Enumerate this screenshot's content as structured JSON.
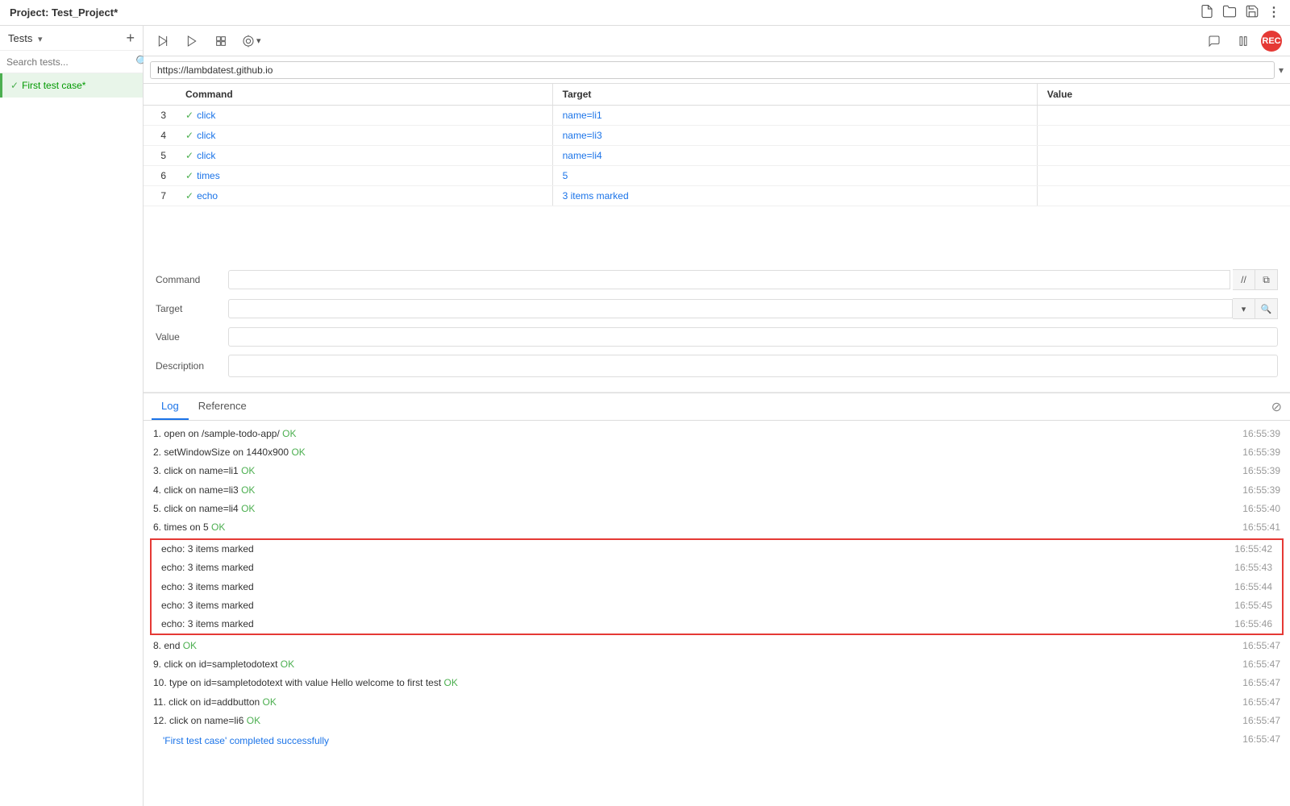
{
  "topbar": {
    "title": "Project: ",
    "project_name": "Test_Project*"
  },
  "left_panel": {
    "tests_label": "Tests",
    "dropdown_arrow": "▾",
    "add_btn": "+",
    "search_placeholder": "Search tests...",
    "test_item": "First test case*"
  },
  "toolbar": {
    "url": "https://lambdatest.github.io"
  },
  "table": {
    "columns": [
      "Command",
      "Target",
      "Value"
    ],
    "rows": [
      {
        "num": "3",
        "command": "click",
        "target": "name=li1",
        "value": ""
      },
      {
        "num": "4",
        "command": "click",
        "target": "name=li3",
        "value": ""
      },
      {
        "num": "5",
        "command": "click",
        "target": "name=li4",
        "value": ""
      },
      {
        "num": "6",
        "command": "times",
        "target": "5",
        "value": ""
      },
      {
        "num": "7",
        "command": "echo",
        "target": "3 items marked",
        "value": ""
      }
    ]
  },
  "cmd_edit": {
    "command_label": "Command",
    "target_label": "Target",
    "value_label": "Value",
    "description_label": "Description"
  },
  "log": {
    "tab_log": "Log",
    "tab_reference": "Reference",
    "entries": [
      {
        "text": "1.  open on /sample-todo-app/",
        "ok": "OK",
        "time": "16:55:39"
      },
      {
        "text": "2.  setWindowSize on 1440x900",
        "ok": "OK",
        "time": "16:55:39"
      },
      {
        "text": "3.  click on name=li1",
        "ok": "OK",
        "time": "16:55:39"
      },
      {
        "text": "4.  click on name=li3",
        "ok": "OK",
        "time": "16:55:39"
      },
      {
        "text": "5.  click on name=li4",
        "ok": "OK",
        "time": "16:55:40"
      },
      {
        "text": "6.  times on 5",
        "ok": "OK",
        "time": "16:55:41"
      },
      {
        "highlighted": true,
        "entries": [
          {
            "text": "echo: 3 items marked",
            "time": "16:55:42"
          },
          {
            "text": "echo: 3 items marked",
            "time": "16:55:43"
          },
          {
            "text": "echo: 3 items marked",
            "time": "16:55:44"
          },
          {
            "text": "echo: 3 items marked",
            "time": "16:55:45"
          },
          {
            "text": "echo: 3 items marked",
            "time": "16:55:46"
          }
        ]
      },
      {
        "text": "8.  end",
        "ok": "OK",
        "time": "16:55:47"
      },
      {
        "text": "9.  click on id=sampletodotext",
        "ok": "OK",
        "time": "16:55:47"
      },
      {
        "text": "10.  type on id=sampletodotext with value Hello welcome to first test",
        "ok": "OK",
        "time": "16:55:47"
      },
      {
        "text": "11.  click on id=addbutton",
        "ok": "OK",
        "time": "16:55:47"
      },
      {
        "text": "12.  click on name=li6",
        "ok": "OK",
        "time": "16:55:47"
      },
      {
        "success": true,
        "text": "'First test case' completed successfully",
        "time": "16:55:47"
      }
    ]
  }
}
